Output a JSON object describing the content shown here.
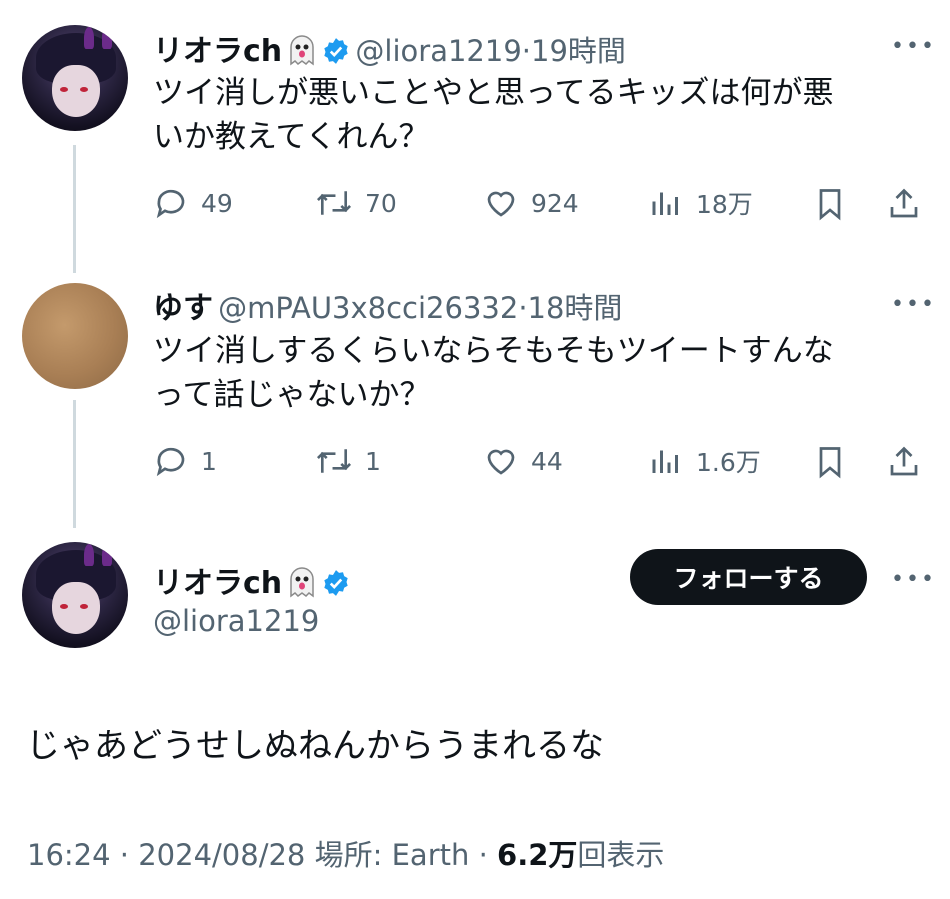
{
  "tweet1": {
    "name": "リオラch",
    "handle": "@liora1219",
    "time": "19時間",
    "lines": [
      "ツイ消しが悪いことやと思ってるキッズは何が悪",
      "いか教えてくれん？"
    ],
    "stats": {
      "replies": "49",
      "retweets": "70",
      "likes": "924",
      "views": "18万"
    }
  },
  "tweet2": {
    "name": "ゆす",
    "handle": "@mPAU3x8cci26332",
    "time": "18時間",
    "lines": [
      "ツイ消しするくらいならそもそもツイートすんな",
      "って話じゃないか？"
    ],
    "stats": {
      "replies": "1",
      "retweets": "1",
      "likes": "44",
      "views": "1.6万"
    }
  },
  "main": {
    "name": "リオラch",
    "handle": "@liora1219",
    "follow_label": "フォローする",
    "text": "じゃあどうせしぬねんからうまれるな",
    "time": "16:24",
    "date": "2024/08/28",
    "location_label": "場所:",
    "location": "Earth",
    "views_count": "6.2万",
    "views_label": "回表示"
  },
  "separator": "·",
  "more_label": "•••",
  "icons": [
    "ghost-emoji-icon",
    "verified-badge-icon",
    "reply-icon",
    "retweet-icon",
    "like-icon",
    "views-icon",
    "bookmark-icon",
    "share-icon",
    "more-icon"
  ],
  "colors": {
    "verified": "#1d9bf0",
    "text": "#0f1419",
    "secondary": "#536471",
    "button": "#0f1419"
  }
}
